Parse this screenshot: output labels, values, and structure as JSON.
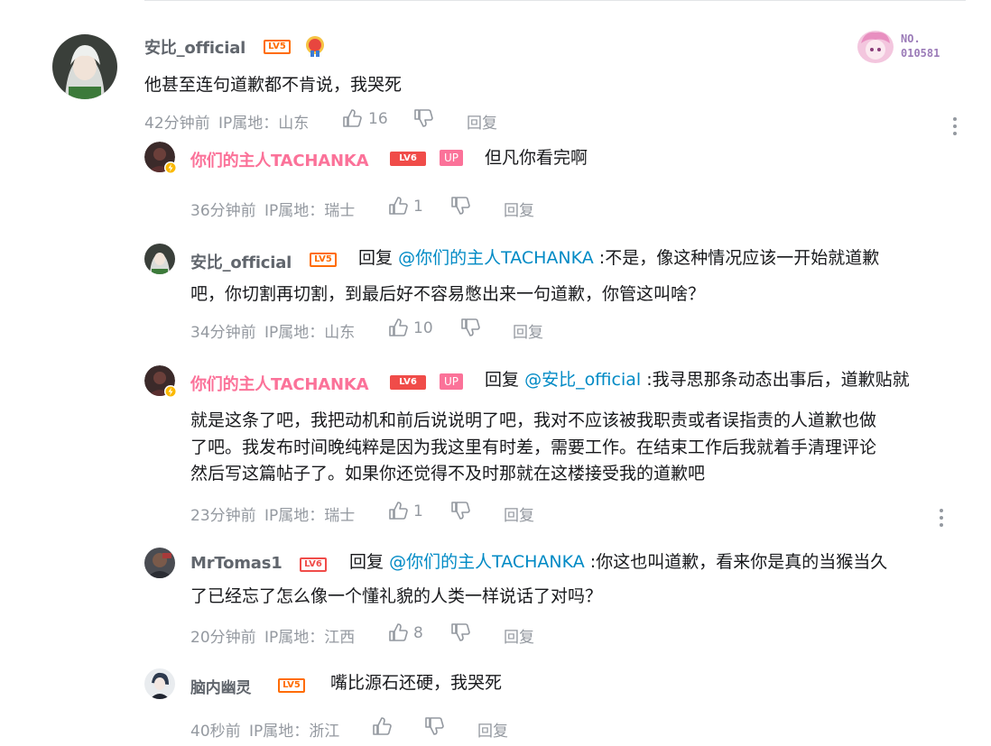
{
  "comments": [
    {
      "user": "安比_official",
      "level": "LV5",
      "text": "他甚至连句道歉都不肯说，我哭死",
      "time": "42分钟前",
      "ip": "IP属地：山东",
      "likes": "16",
      "reply_label": "回复",
      "fan_badge_no": "NO.",
      "fan_badge_num": "010581"
    }
  ],
  "replies": [
    {
      "user": "你们的主人TACHANKA",
      "level": "LV6",
      "up_label": "UP",
      "prefix": "",
      "mention": "",
      "text": "但凡你看完啊",
      "time": "36分钟前",
      "ip": "IP属地：瑞士",
      "likes": "1",
      "reply_label": "回复"
    },
    {
      "user": "安比_official",
      "level": "LV5",
      "prefix": "回复",
      "mention": "@你们的主人TACHANKA",
      "text_line1": ":不是，像这种情况应该一开始就道歉",
      "text_line2": "吧，你切割再切割，到最后好不容易憋出来一句道歉，你管这叫啥？",
      "time": "34分钟前",
      "ip": "IP属地：山东",
      "likes": "10",
      "reply_label": "回复"
    },
    {
      "user": "你们的主人TACHANKA",
      "level": "LV6",
      "up_label": "UP",
      "prefix": "回复",
      "mention": "@安比_official",
      "text_line1": ":我寻思那条动态出事后，道歉贴就",
      "text_line2": "就是这条了吧，我把动机和前后说说明了吧，我对不应该被我职责或者误指责的人道歉也做",
      "text_line3": "了吧。我发布时间晚纯粹是因为我这里有时差，需要工作。在结束工作后我就着手清理评论",
      "text_line4": "然后写这篇帖子了。如果你还觉得不及时那就在这楼接受我的道歉吧",
      "time": "23分钟前",
      "ip": "IP属地：瑞士",
      "likes": "1",
      "reply_label": "回复"
    },
    {
      "user": "MrTomas1",
      "level": "LV6",
      "prefix": "回复",
      "mention": "@你们的主人TACHANKA",
      "text_line1": ":你这也叫道歉，看来你是真的当猴当久",
      "text_line2": "了已经忘了怎么像一个懂礼貌的人类一样说话了对吗？",
      "time": "20分钟前",
      "ip": "IP属地：江西",
      "likes": "8",
      "reply_label": "回复"
    },
    {
      "user": "脑内幽灵",
      "level": "LV5",
      "text": "嘴比源石还硬，我哭死",
      "time": "40秒前",
      "ip": "IP属地：浙江",
      "likes": "",
      "reply_label": "回复"
    }
  ],
  "colors": {
    "pink_name": "#fb7299",
    "mention": "#008ac5",
    "meta": "#9499a0",
    "lv5": "#ff6c00",
    "lv6": "#f04c49"
  },
  "icons": [
    "like-icon",
    "dislike-icon",
    "more-icon",
    "lightning-badge-icon"
  ]
}
